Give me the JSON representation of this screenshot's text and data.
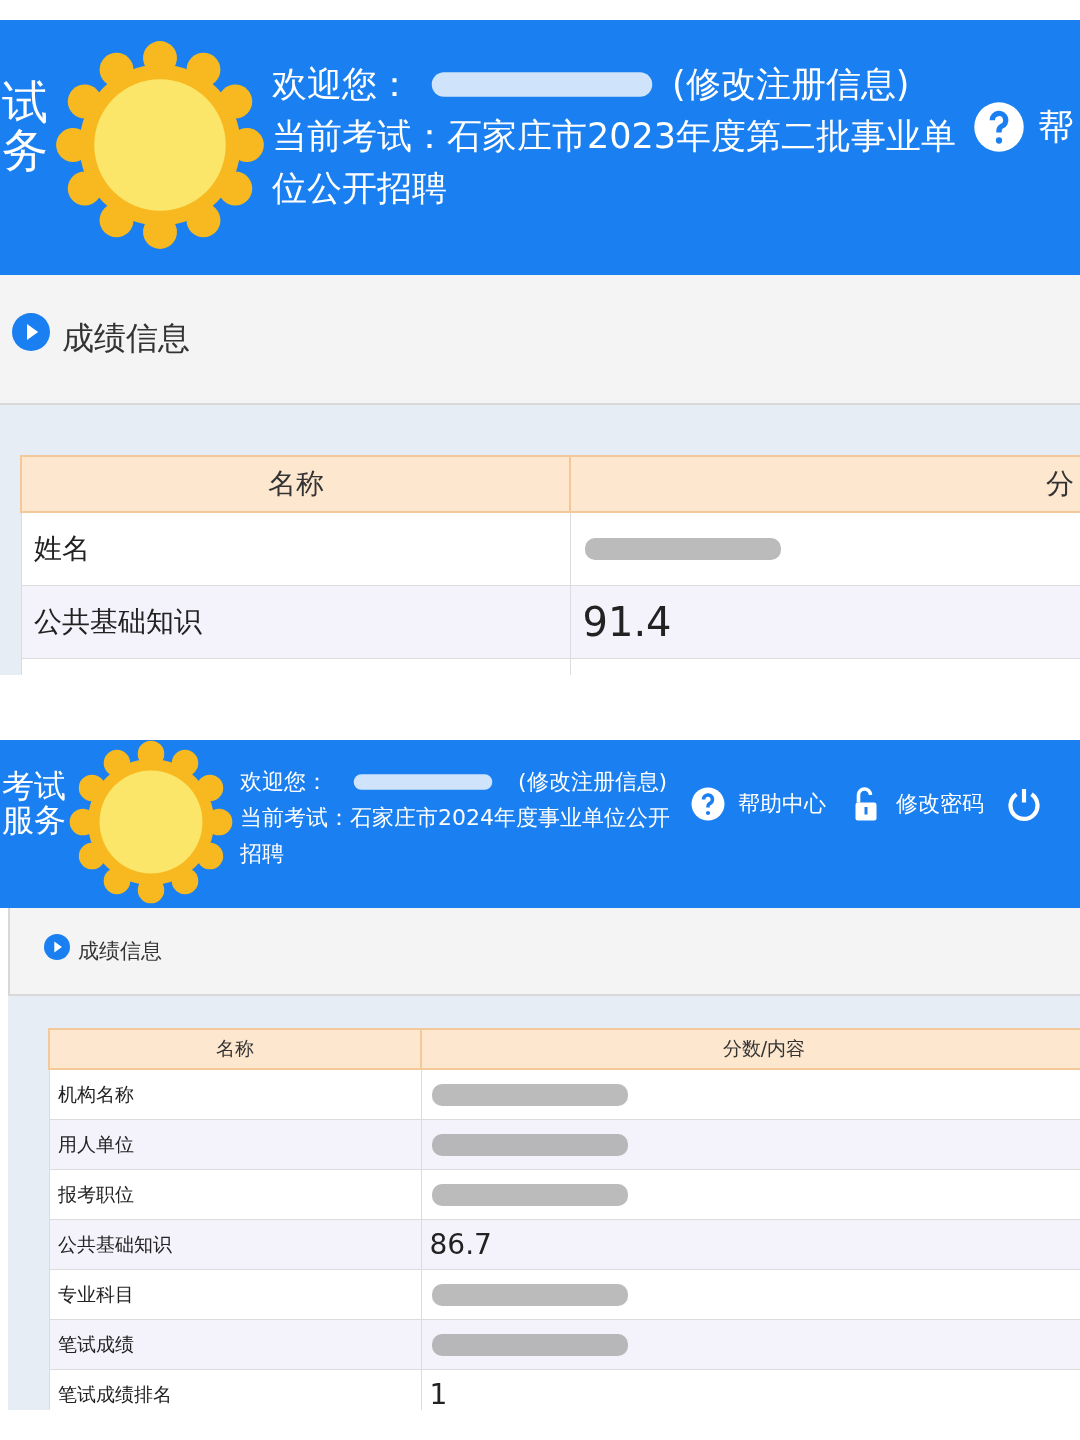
{
  "panels": [
    {
      "brand_lines": [
        "试",
        "务"
      ],
      "welcome_label": "欢迎您：",
      "name_redacted": true,
      "edit_link": "(修改注册信息)",
      "exam_label": "当前考试：",
      "exam_name": "石家庄市2023年度第二批事业单位公开招聘",
      "header_links": [
        {
          "kind": "help",
          "label": "帮"
        }
      ],
      "section_title": "成绩信息",
      "table": {
        "columns": [
          "名称",
          "分"
        ],
        "rows": [
          {
            "name": "姓名",
            "value": "",
            "redacted": true
          },
          {
            "name": "公共基础知识",
            "value": "91.4",
            "redacted": false
          }
        ]
      }
    },
    {
      "brand_lines": [
        "考试",
        "服务"
      ],
      "welcome_label": "欢迎您：",
      "name_redacted": true,
      "edit_link": "(修改注册信息)",
      "exam_label": "当前考试：",
      "exam_name": "石家庄市2024年度事业单位公开招聘",
      "header_links": [
        {
          "kind": "help",
          "label": "帮助中心"
        },
        {
          "kind": "lock",
          "label": "修改密码"
        },
        {
          "kind": "power"
        }
      ],
      "section_title": "成绩信息",
      "table": {
        "columns": [
          "名称",
          "分数/内容"
        ],
        "rows": [
          {
            "name": "机构名称",
            "value": "",
            "redacted": true
          },
          {
            "name": "用人单位",
            "value": "",
            "redacted": true
          },
          {
            "name": "报考职位",
            "value": "",
            "redacted": true
          },
          {
            "name": "公共基础知识",
            "value": "86.7",
            "redacted": false
          },
          {
            "name": "专业科目",
            "value": "",
            "redacted": true
          },
          {
            "name": "笔试成绩",
            "value": "",
            "redacted": true
          },
          {
            "name": "笔试成绩排名",
            "value": "1",
            "redacted": false
          }
        ]
      }
    }
  ]
}
